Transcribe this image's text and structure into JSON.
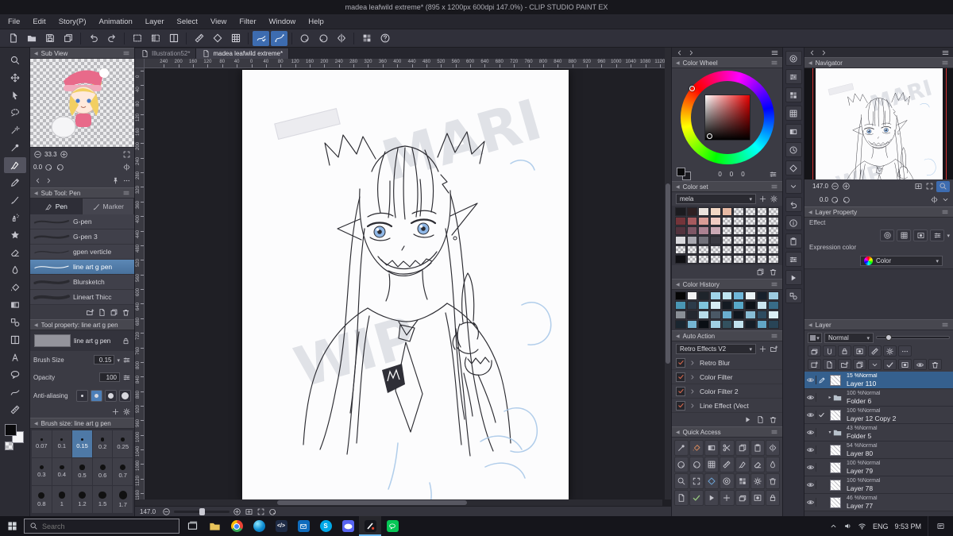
{
  "title_bar": {
    "title": "madea leafwild extreme* (895 x 1200px 600dpi 147.0%)  - CLIP STUDIO PAINT EX"
  },
  "menu": {
    "items": [
      "File",
      "Edit",
      "Story(P)",
      "Animation",
      "Layer",
      "Select",
      "View",
      "Filter",
      "Window",
      "Help"
    ]
  },
  "toolbar": {
    "buttons": [
      {
        "name": "new-document",
        "icon": "page"
      },
      {
        "name": "open-file",
        "icon": "folderO"
      },
      {
        "name": "save-file",
        "icon": "floppy"
      },
      {
        "name": "export-file",
        "icon": "copy"
      },
      {
        "name": "sep1",
        "sep": true
      },
      {
        "name": "undo",
        "icon": "undo"
      },
      {
        "name": "redo",
        "icon": "redo"
      },
      {
        "name": "sep2",
        "sep": true
      },
      {
        "name": "deselect",
        "icon": "dashrect"
      },
      {
        "name": "invert-selection",
        "icon": "dashrect2"
      },
      {
        "name": "selection-border",
        "icon": "frame"
      },
      {
        "name": "sep3",
        "sep": true
      },
      {
        "name": "snap-to-ruler",
        "icon": "ruler"
      },
      {
        "name": "snap-to-special-ruler",
        "icon": "diamond"
      },
      {
        "name": "snap-to-grid",
        "icon": "grid"
      },
      {
        "name": "sep4",
        "sep": true
      },
      {
        "name": "stabilize-stroke",
        "icon": "linecheck",
        "active": true
      },
      {
        "name": "vector-snap",
        "icon": "linecurve",
        "active": true
      },
      {
        "name": "sep5",
        "sep": true
      },
      {
        "name": "rotate-view-left",
        "icon": "rotL"
      },
      {
        "name": "rotate-view-right",
        "icon": "rotR"
      },
      {
        "name": "flip-view",
        "icon": "flipH"
      },
      {
        "name": "sep6",
        "sep": true
      },
      {
        "name": "material-palette",
        "icon": "swatchGrid"
      },
      {
        "name": "help",
        "icon": "help"
      }
    ]
  },
  "toolstrip": {
    "tools": [
      {
        "name": "zoom-tool",
        "icon": "magnifier"
      },
      {
        "name": "move-tool",
        "icon": "move"
      },
      {
        "name": "operation-tool",
        "icon": "cursor"
      },
      {
        "name": "lasso-tool",
        "icon": "lasso"
      },
      {
        "name": "auto-select-tool",
        "icon": "wand"
      },
      {
        "name": "eyedropper-tool",
        "icon": "dropper"
      },
      {
        "name": "pen-tool",
        "icon": "pen",
        "active": true
      },
      {
        "name": "pencil-tool",
        "icon": "pencil"
      },
      {
        "name": "brush-tool",
        "icon": "brush"
      },
      {
        "name": "airbrush-tool",
        "icon": "airbrush"
      },
      {
        "name": "decoration-tool",
        "icon": "deco"
      },
      {
        "name": "eraser-tool",
        "icon": "eraser"
      },
      {
        "name": "blend-tool",
        "icon": "blend"
      },
      {
        "name": "fill-tool",
        "icon": "fill"
      },
      {
        "name": "gradient-tool",
        "icon": "gradient"
      },
      {
        "name": "figure-tool",
        "icon": "figure"
      },
      {
        "name": "frame-border-tool",
        "icon": "frame"
      },
      {
        "name": "text-tool",
        "icon": "textA"
      },
      {
        "name": "balloon-tool",
        "icon": "balloon"
      },
      {
        "name": "line-correction-tool",
        "icon": "wave"
      },
      {
        "name": "ruler-tool",
        "icon": "ruler"
      }
    ]
  },
  "left_panel": {
    "sub_view": {
      "title": "Sub View",
      "zoom_value": "33.3",
      "rotate_value": "0.0"
    },
    "sub_tool": {
      "title": "Sub Tool: Pen",
      "tabs": [
        {
          "label": "Pen",
          "active": true
        },
        {
          "label": "Marker",
          "active": false
        }
      ],
      "brushes": [
        {
          "label": "G-pen",
          "selected": false
        },
        {
          "label": "G-pen 3",
          "selected": false
        },
        {
          "label": "gpen verticle",
          "selected": false
        },
        {
          "label": "line art g pen",
          "selected": true
        },
        {
          "label": "Blursketch",
          "selected": false
        },
        {
          "label": "Lineart Thicc",
          "selected": false
        }
      ]
    },
    "tool_property": {
      "title": "Tool property: line art g pen",
      "tool_name": "line art g pen",
      "brush_size_label": "Brush Size",
      "brush_size_value": "0.15",
      "opacity_label": "Opacity",
      "opacity_value": "100",
      "anti_aliasing_label": "Anti-aliasing"
    },
    "brush_size_panel": {
      "title": "Brush size: line art g pen",
      "selected": "0.15",
      "sizes": [
        "0.07",
        "0.1",
        "0.15",
        "0.2",
        "0.25",
        "0.3",
        "0.4",
        "0.5",
        "0.6",
        "0.7",
        "0.8",
        "1",
        "1.2",
        "1.5",
        "1.7"
      ]
    }
  },
  "canvas": {
    "tabs": [
      {
        "label": "Illustration52*",
        "active": false
      },
      {
        "label": "madea leafwild extreme*",
        "active": true
      }
    ],
    "zoom_value": "147.0",
    "watermark": [
      "MARI",
      "WIP"
    ],
    "ruler_top_labels": [
      "240",
      "200",
      "160",
      "120",
      "80",
      "40",
      "0",
      "40",
      "80",
      "120",
      "160",
      "200",
      "240",
      "280",
      "320",
      "360",
      "400",
      "440",
      "480",
      "520",
      "560",
      "600",
      "640",
      "680",
      "720",
      "760",
      "800",
      "840",
      "880",
      "920",
      "960",
      "1000",
      "1040",
      "1080",
      "1120"
    ],
    "ruler_left_labels": [
      "0",
      "40",
      "80",
      "120",
      "160",
      "200",
      "240",
      "280",
      "320",
      "360",
      "400",
      "440",
      "480",
      "520",
      "560",
      "600",
      "640",
      "680",
      "720",
      "760",
      "800",
      "840",
      "880",
      "920",
      "960",
      "1000",
      "1040",
      "1080",
      "1120",
      "1160",
      "1200"
    ]
  },
  "color_wheel": {
    "title": "Color Wheel",
    "rgb": [
      "0",
      "0",
      "0"
    ]
  },
  "color_set": {
    "title": "Color set",
    "name": "mela",
    "swatches": [
      [
        "#1b1b1f",
        "#2e2022",
        "#eae3dd",
        "#f2d8c5",
        "#e7baa5",
        "t",
        "t",
        "t",
        "t"
      ],
      [
        "#74343a",
        "#a65a5e",
        "#d99c96",
        "#efcbc2",
        "t",
        "t",
        "t",
        "t",
        "t"
      ],
      [
        "#53333e",
        "#7d5665",
        "#ab8292",
        "#caa8b4",
        "t",
        "t",
        "t",
        "t",
        "t"
      ],
      [
        "#dadade",
        "#a8a8b0",
        "#71717a",
        "#3a3a42",
        "t",
        "t",
        "t",
        "t",
        "t"
      ],
      [
        "t",
        "t",
        "t",
        "t",
        "t",
        "t",
        "t",
        "t",
        "t"
      ],
      [
        "#0f0f13",
        "t",
        "t",
        "t",
        "t",
        "t",
        "t",
        "t",
        "t"
      ]
    ]
  },
  "color_history": {
    "title": "Color History",
    "swatches": [
      [
        "#060606",
        "#f2f2f3",
        "#1e242b",
        "#9fd3e8",
        "#bfe6f2",
        "#6fb6d8",
        "#e9f2f5",
        "#17202c",
        "#9ccbe0"
      ],
      [
        "#4a96b4",
        "#2c3b4a",
        "#7fc4dc",
        "#d6ecf4",
        "#141a22",
        "#58a8c8",
        "#0e1218",
        "#cde6f0",
        "#386c88"
      ],
      [
        "#8a8f96",
        "#242830",
        "#b8dcea",
        "#4a5866",
        "#6aaecf",
        "#10161e",
        "#88bcd4",
        "#2e4b60",
        "#dceff6"
      ],
      [
        "#1a2630",
        "#74b4d2",
        "#0a0e14",
        "#9fd0e4",
        "#33515f",
        "#c2e2ee",
        "#151d26",
        "#62a6c6",
        "#284456"
      ]
    ]
  },
  "auto_action": {
    "title": "Auto Action",
    "set_name": "Retro Effects V2",
    "actions": [
      {
        "label": "Retro Blur",
        "checked": true
      },
      {
        "label": "Color Filter",
        "checked": true
      },
      {
        "label": "Color Filter 2",
        "checked": true
      },
      {
        "label": "Line Effect (Vect",
        "checked": true
      }
    ]
  },
  "quick_access": {
    "title": "Quick Access",
    "items": [
      {
        "icon": "dropper"
      },
      {
        "icon": "fill",
        "color": "#d98a5c"
      },
      {
        "icon": "gradient"
      },
      {
        "icon": "scissors"
      },
      {
        "icon": "copy"
      },
      {
        "icon": "clipboard"
      },
      {
        "icon": "flipH"
      },
      {
        "icon": "rotL"
      },
      {
        "icon": "rotR"
      },
      {
        "icon": "grid"
      },
      {
        "icon": "ruler"
      },
      {
        "icon": "pen"
      },
      {
        "icon": "eraser"
      },
      {
        "icon": "blend"
      },
      {
        "icon": "magnifier"
      },
      {
        "icon": "expand"
      },
      {
        "icon": "diamond",
        "color": "#6fa8dc"
      },
      {
        "icon": "wheelIcon"
      },
      {
        "icon": "swatchGrid"
      },
      {
        "icon": "gear"
      },
      {
        "icon": "trash"
      },
      {
        "icon": "page"
      },
      {
        "icon": "check",
        "color": "#93c47d"
      },
      {
        "icon": "playIcon"
      },
      {
        "icon": "plus"
      },
      {
        "icon": "layers"
      },
      {
        "icon": "mask"
      },
      {
        "icon": "lock"
      }
    ]
  },
  "dock_icons": [
    {
      "name": "dock-color-wheel",
      "icon": "wheelIcon"
    },
    {
      "name": "dock-color-slider",
      "icon": "sliders"
    },
    {
      "name": "dock-color-set",
      "icon": "swatchGrid"
    },
    {
      "name": "dock-intermediate-color",
      "icon": "grid"
    },
    {
      "name": "dock-approximate-color",
      "icon": "gradient"
    },
    {
      "name": "dock-color-history",
      "icon": "histIcon"
    },
    {
      "name": "dock-material",
      "icon": "diamond"
    },
    {
      "name": "dock-download",
      "icon": "chevD"
    },
    {
      "name": "dock-history",
      "icon": "undo"
    },
    {
      "name": "dock-information",
      "icon": "infoIcon"
    },
    {
      "name": "dock-item-bank",
      "icon": "clipboard"
    },
    {
      "name": "dock-sub-tool-detail",
      "icon": "sliders"
    },
    {
      "name": "dock-timeline",
      "icon": "playIcon"
    },
    {
      "name": "dock-all-sides-view",
      "icon": "figure"
    }
  ],
  "navigator": {
    "title": "Navigator",
    "zoom_value": "147.0",
    "rotate_value": "0.0"
  },
  "layer_property": {
    "title": "Layer Property",
    "effect_label": "Effect",
    "expression_label": "Expression color",
    "expression_value": "Color"
  },
  "layer_panel": {
    "title": "Layer",
    "blend_mode": "Normal",
    "items": [
      {
        "opacity": "15",
        "mode": "%Normal",
        "name": "Layer 110",
        "type": "layer",
        "selected": true,
        "editing": true,
        "visible": true
      },
      {
        "opacity": "100",
        "mode": "%Normal",
        "name": "Folder 6",
        "type": "folder",
        "expanded": false,
        "visible": true
      },
      {
        "opacity": "100",
        "mode": "%Normal",
        "name": "Layer 12 Copy 2",
        "type": "layer",
        "checked": true,
        "visible": true
      },
      {
        "opacity": "43",
        "mode": "%Normal",
        "name": "Folder 5",
        "type": "folder",
        "expanded": true,
        "visible": true
      },
      {
        "opacity": "54",
        "mode": "%Normal",
        "name": "Layer 80",
        "type": "layer",
        "visible": true
      },
      {
        "opacity": "100",
        "mode": "%Normal",
        "name": "Layer 79",
        "type": "layer",
        "visible": true
      },
      {
        "opacity": "100",
        "mode": "%Normal",
        "name": "Layer 78",
        "type": "layer",
        "visible": true
      },
      {
        "opacity": "46",
        "mode": "%Normal",
        "name": "Layer 77",
        "type": "layer",
        "visible": true
      }
    ]
  },
  "taskbar": {
    "search_placeholder": "Search",
    "language": "ENG",
    "time": "9:53 PM",
    "apps": [
      {
        "name": "task-view"
      },
      {
        "name": "file-explorer"
      },
      {
        "name": "chrome"
      },
      {
        "name": "edge"
      },
      {
        "name": "code-app"
      },
      {
        "name": "mail-app"
      },
      {
        "name": "skype-app"
      },
      {
        "name": "discord"
      },
      {
        "name": "clip-studio",
        "active": true
      },
      {
        "name": "line-app"
      }
    ]
  }
}
